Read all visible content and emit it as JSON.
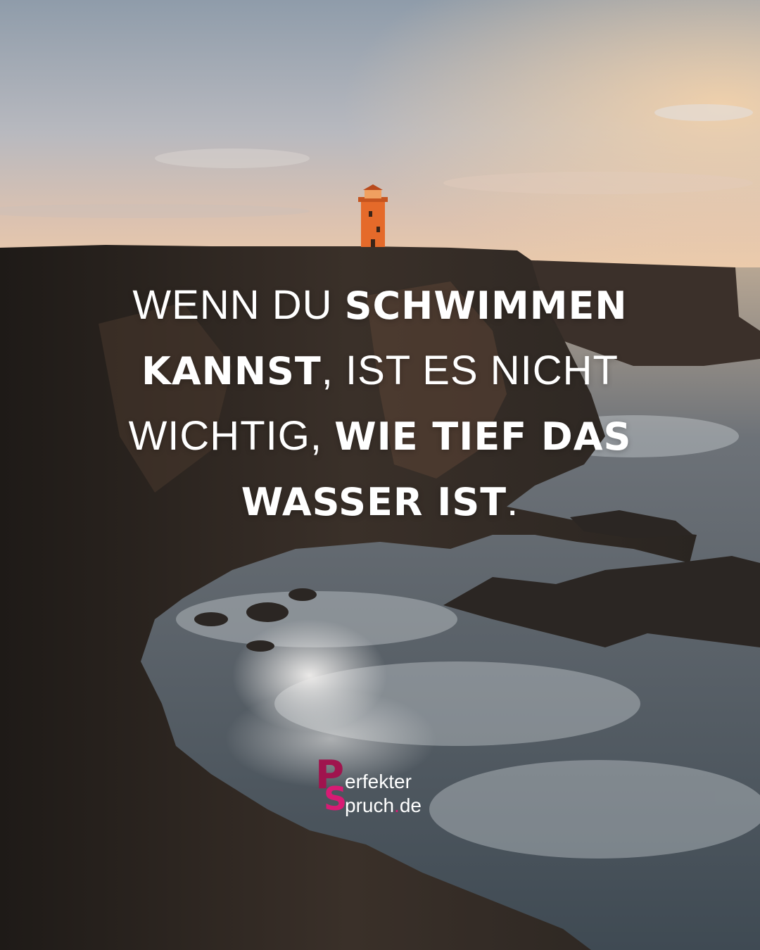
{
  "quote": {
    "line1": [
      {
        "text": "Wenn du ",
        "style": "light"
      },
      {
        "text": "schwimmen",
        "style": "bold"
      }
    ],
    "line2": [
      {
        "text": "kannst",
        "style": "bold"
      },
      {
        "text": ", ist es nicht",
        "style": "light"
      }
    ],
    "line3": [
      {
        "text": "wichtig, ",
        "style": "light"
      },
      {
        "text": "wie tief das",
        "style": "bold"
      }
    ],
    "line4": [
      {
        "text": "Wasser ist",
        "style": "bold"
      },
      {
        "text": ".",
        "style": "light"
      }
    ]
  },
  "logo": {
    "letter_p": "P",
    "letter_s": "S",
    "line1": "erfekter",
    "line2": "pruch",
    "dot": ".",
    "tld": "de",
    "brand_color": "#a0144e",
    "accent_color": "#d81b74"
  },
  "scene": {
    "icons": [
      "lighthouse-icon",
      "cliff-shape",
      "sea-waves"
    ],
    "colors": {
      "sky_top": "#9eabb9",
      "sky_horizon": "#f2c9a2",
      "lighthouse": "#e8682a",
      "cliff": "#2e2824",
      "sea": "#5a6670",
      "foam": "#e6ebee"
    }
  }
}
